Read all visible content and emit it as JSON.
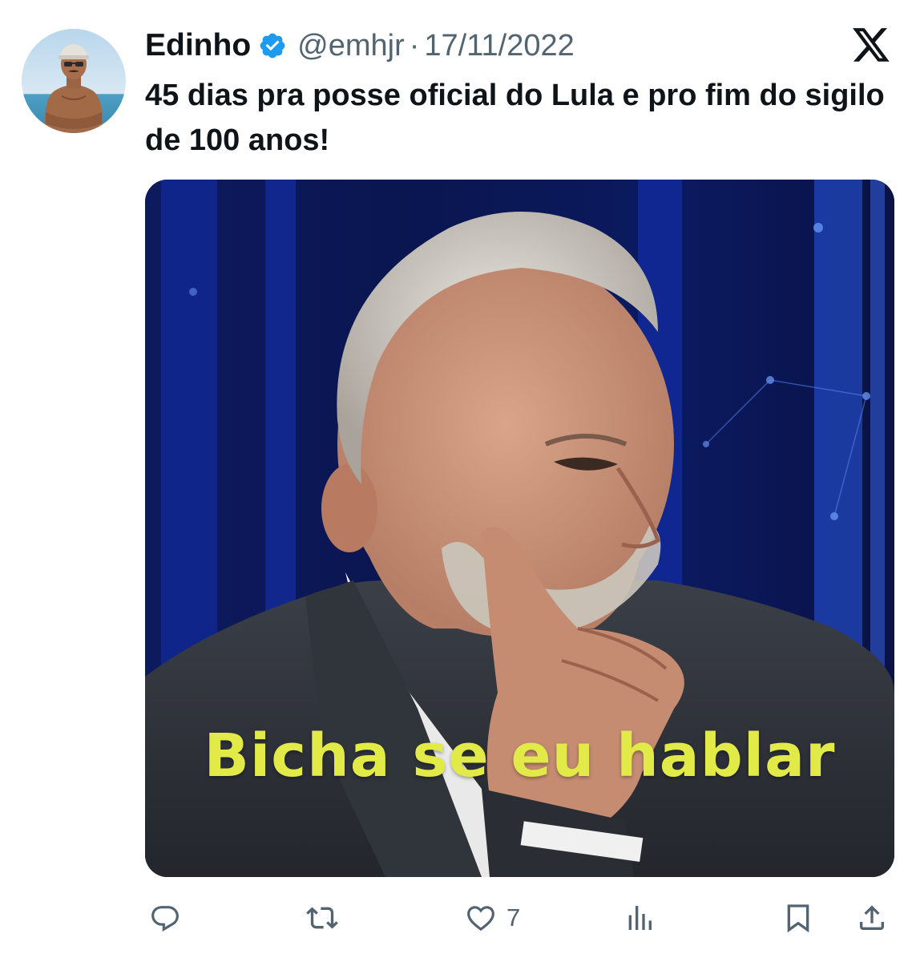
{
  "tweet": {
    "author": {
      "display_name": "Edinho",
      "handle": "@emhjr",
      "separator": "·",
      "date": "17/11/2022",
      "verified_icon": "verified-badge-icon",
      "verified_color": "#1d9bf0"
    },
    "text": "45 dias pra posse oficial do Lula e pro fim do sigilo de 100 anos!",
    "media": {
      "caption": "Bicha se eu hablar",
      "caption_color": "#e2ea48"
    },
    "platform_icon": "x-logo-icon",
    "actions": {
      "reply_icon": "reply-icon",
      "retweet_icon": "retweet-icon",
      "like_icon": "heart-icon",
      "like_count": "7",
      "views_icon": "views-icon",
      "bookmark_icon": "bookmark-icon",
      "share_icon": "share-icon"
    }
  }
}
